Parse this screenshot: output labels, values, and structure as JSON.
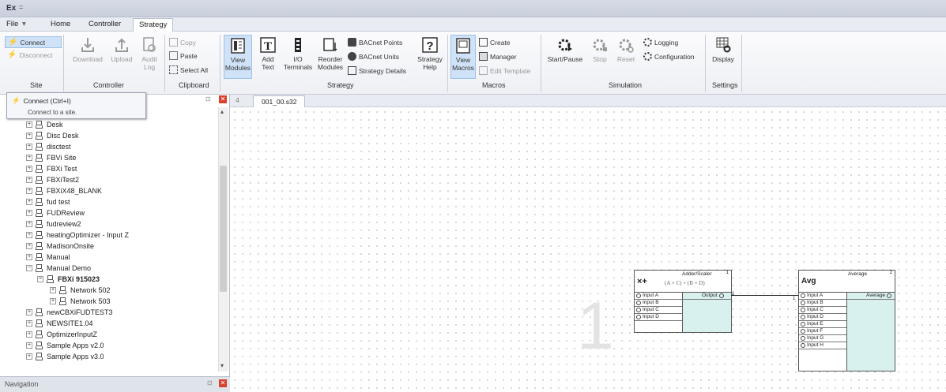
{
  "app": {
    "icon_label": "Ex",
    "qat": "="
  },
  "menu": {
    "file": "File",
    "home": "Home",
    "controller": "Controller",
    "strategy": "Strategy"
  },
  "ribbon": {
    "site": {
      "connect": "Connect",
      "disconnect": "Disconnect",
      "group": "Site"
    },
    "controller": {
      "download": "Download",
      "upload": "Upload",
      "audit_line1": "Audit",
      "audit_line2": "Log",
      "group": "Controller"
    },
    "clipboard": {
      "copy": "Copy",
      "paste": "Paste",
      "select_all": "Select All",
      "group": "Clipboard"
    },
    "strategy": {
      "view_modules_1": "View",
      "view_modules_2": "Modules",
      "add_text_1": "Add",
      "add_text_2": "Text",
      "io_1": "I/O",
      "io_2": "Terminals",
      "reorder_1": "Reorder",
      "reorder_2": "Modules",
      "bacnet_points": "BACnet Points",
      "bacnet_units": "BACnet Units",
      "strategy_details": "Strategy Details",
      "strategy_help_1": "Strategy",
      "strategy_help_2": "Help",
      "group": "Strategy"
    },
    "macros": {
      "view_1": "View",
      "view_2": "Macros",
      "create": "Create",
      "manager": "Manager",
      "edit_template": "Edit Template",
      "group": "Macros"
    },
    "simulation": {
      "start_pause": "Start/Pause",
      "stop": "Stop",
      "reset": "Reset",
      "logging": "Logging",
      "configuration": "Configuration",
      "group": "Simulation"
    },
    "settings": {
      "display": "Display",
      "group": "Settings"
    }
  },
  "tooltip": {
    "title": "Connect (Ctrl+I)",
    "desc": "Connect to a site."
  },
  "tree": [
    {
      "label": "Desk"
    },
    {
      "label": "Disc Desk"
    },
    {
      "label": "disctest"
    },
    {
      "label": "FBVi Site"
    },
    {
      "label": "FBXi Test"
    },
    {
      "label": "FBXiTest2"
    },
    {
      "label": "FBXiX48_BLANK"
    },
    {
      "label": "fud test"
    },
    {
      "label": "FUDReview"
    },
    {
      "label": "fudreview2"
    },
    {
      "label": "heatingOptimizer - Input Z"
    },
    {
      "label": "MadisonOnsite"
    },
    {
      "label": "Manual"
    },
    {
      "label": "Manual Demo"
    },
    {
      "label": "FBXi 915023"
    },
    {
      "label": "Network 502"
    },
    {
      "label": "Network 503"
    },
    {
      "label": "newCBXiFUDTEST3"
    },
    {
      "label": "NEWSITE1.04"
    },
    {
      "label": "OptimizerInputZ"
    },
    {
      "label": "Sample Apps v2.0"
    },
    {
      "label": "Sample Apps v3.0"
    }
  ],
  "nav": {
    "label": "Navigation"
  },
  "doc": {
    "tab": "001_00.s32",
    "page_marker": "4"
  },
  "canvas": {
    "page_number": "1"
  },
  "adder": {
    "symbol": "×+",
    "title": "Adder/Scaler",
    "formula": "(A × C) + (B × D)",
    "corner": "1",
    "inputs": [
      "Input A",
      "Input B",
      "Input C",
      "Input D"
    ],
    "output": "Output",
    "out_idx": "1"
  },
  "average": {
    "symbol": "Avg",
    "title": "Average",
    "corner": "2",
    "inputs": [
      "Input A",
      "Input B",
      "Input C",
      "Input D",
      "Input E",
      "Input F",
      "Input G",
      "Input H"
    ],
    "output": "Average",
    "in_idx": "1"
  }
}
